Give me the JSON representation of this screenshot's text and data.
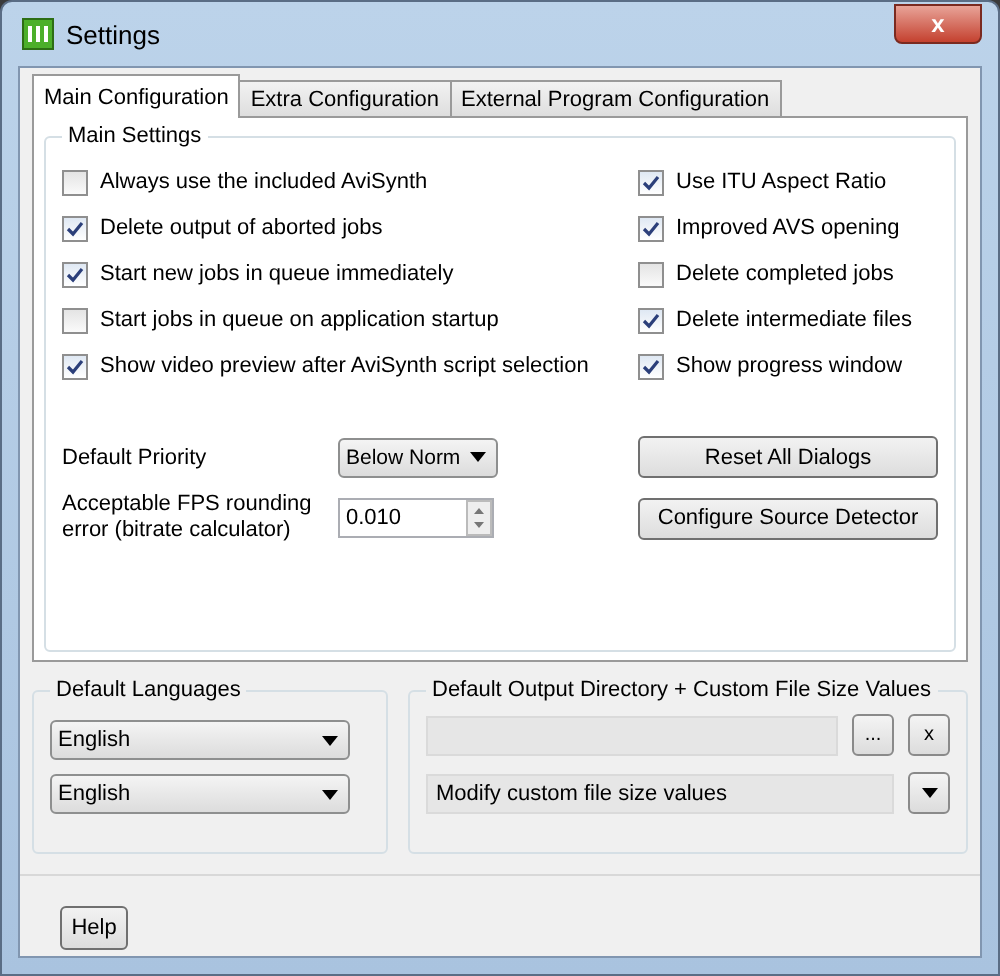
{
  "window": {
    "title": "Settings",
    "close": "x"
  },
  "tabs": [
    {
      "label": "Main Configuration",
      "selected": true
    },
    {
      "label": "Extra Configuration",
      "selected": false
    },
    {
      "label": "External Program Configuration",
      "selected": false
    }
  ],
  "main_settings": {
    "title": "Main Settings",
    "left_options": [
      {
        "label": "Always use the included AviSynth",
        "checked": false
      },
      {
        "label": "Delete output of aborted jobs",
        "checked": true
      },
      {
        "label": "Start new jobs in queue immediately",
        "checked": true
      },
      {
        "label": "Start jobs in queue on application startup",
        "checked": false
      },
      {
        "label": "Show video preview after AviSynth script selection",
        "checked": true
      }
    ],
    "right_options": [
      {
        "label": "Use ITU Aspect Ratio",
        "checked": true
      },
      {
        "label": "Improved AVS opening",
        "checked": true
      },
      {
        "label": "Delete completed jobs",
        "checked": false
      },
      {
        "label": "Delete intermediate files",
        "checked": true
      },
      {
        "label": "Show progress window",
        "checked": true
      }
    ],
    "default_priority": {
      "label": "Default Priority",
      "value": "Below Norm"
    },
    "fps_rounding": {
      "label": "Acceptable FPS rounding error (bitrate calculator)",
      "value": "0.010"
    },
    "buttons": [
      "Reset All Dialogs",
      "Configure Source Detector"
    ]
  },
  "default_languages": {
    "title": "Default Languages",
    "values": [
      "English",
      "English"
    ]
  },
  "output_directory": {
    "title": "Default Output Directory + Custom File Size Values",
    "browse": "...",
    "clear": "x",
    "file_size_value": "Modify custom file size values"
  },
  "footer": {
    "help": "Help"
  }
}
